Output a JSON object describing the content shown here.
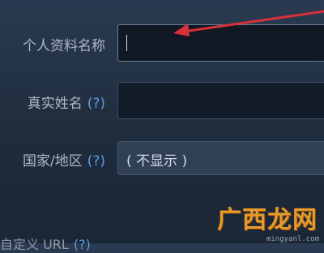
{
  "form": {
    "profile_name": {
      "label": "个人资料名称",
      "value": ""
    },
    "real_name": {
      "label": "真实姓名",
      "help": "(?)",
      "value": ""
    },
    "country": {
      "label": "国家/地区",
      "help": "(?)",
      "selected": "( 不显示 )"
    },
    "custom_url": {
      "label": "自定义 URL",
      "help": "(?)"
    }
  },
  "watermark": {
    "brand": "广西龙网",
    "site": "mingyanl.com"
  },
  "colors": {
    "arrow": "#d9303a",
    "help": "#5a9ee0",
    "background": "#23324a"
  }
}
